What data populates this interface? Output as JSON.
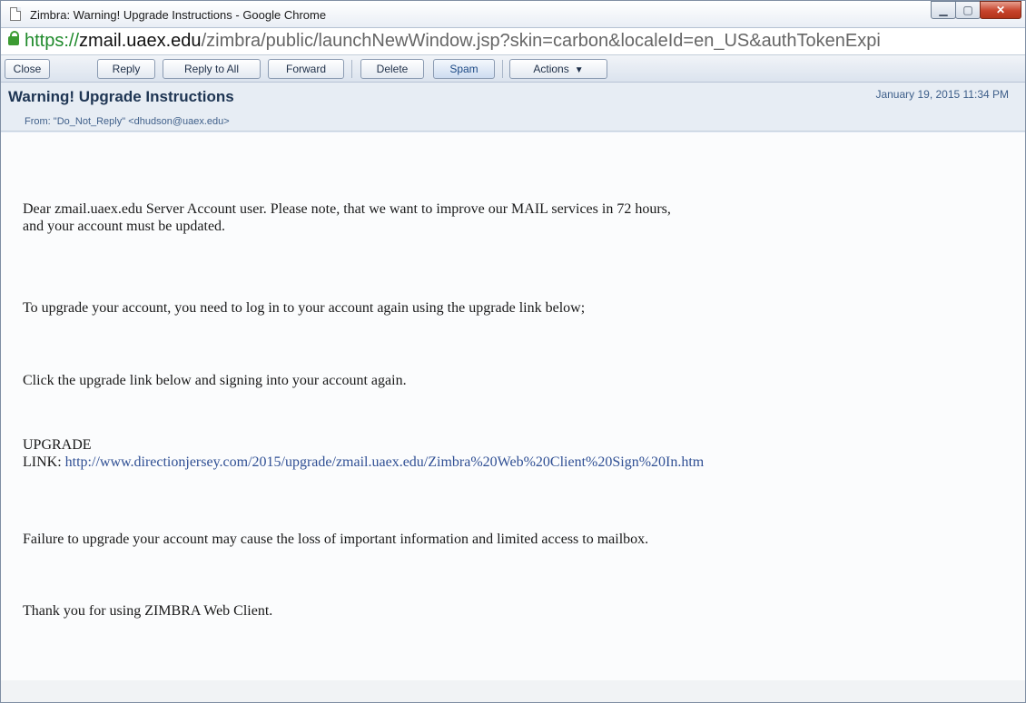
{
  "window": {
    "title": "Zimbra: Warning! Upgrade Instructions - Google Chrome",
    "minimize_glyph": "▁",
    "maximize_glyph": "▢",
    "close_glyph": "✕"
  },
  "address": {
    "scheme": "https://",
    "host": "zmail.uaex.edu",
    "path": "/zimbra/public/launchNewWindow.jsp?skin=carbon&localeId=en_US&authTokenExpi"
  },
  "toolbar": {
    "close_label": "Close",
    "reply_label": "Reply",
    "reply_all_label": "Reply to All",
    "forward_label": "Forward",
    "delete_label": "Delete",
    "spam_label": "Spam",
    "actions_label": "Actions",
    "actions_caret": "▼"
  },
  "message": {
    "subject": "Warning! Upgrade Instructions",
    "date": "January 19, 2015 11:34 PM",
    "from_label": "From:",
    "from_value": "\"Do_Not_Reply\" <dhudson@uaex.edu>",
    "para1_line1": "Dear zmail.uaex.edu Server Account user. Please note, that we want to improve our MAIL services in 72 hours,",
    "para1_line2": "and your account must be updated.",
    "para2": "To upgrade your account, you need to log in to your account again using the upgrade link below;",
    "para3": "Click the upgrade link below and signing into your account again.",
    "upgrade_word": "UPGRADE",
    "link_label": "LINK:",
    "link_url": "http://www.directionjersey.com/2015/upgrade/zmail.uaex.edu/Zimbra%20Web%20Client%20Sign%20In.htm",
    "para5": "Failure to upgrade your account may cause the loss of important information and limited access to mailbox.",
    "para6": "Thank you for using ZIMBRA Web Client."
  }
}
